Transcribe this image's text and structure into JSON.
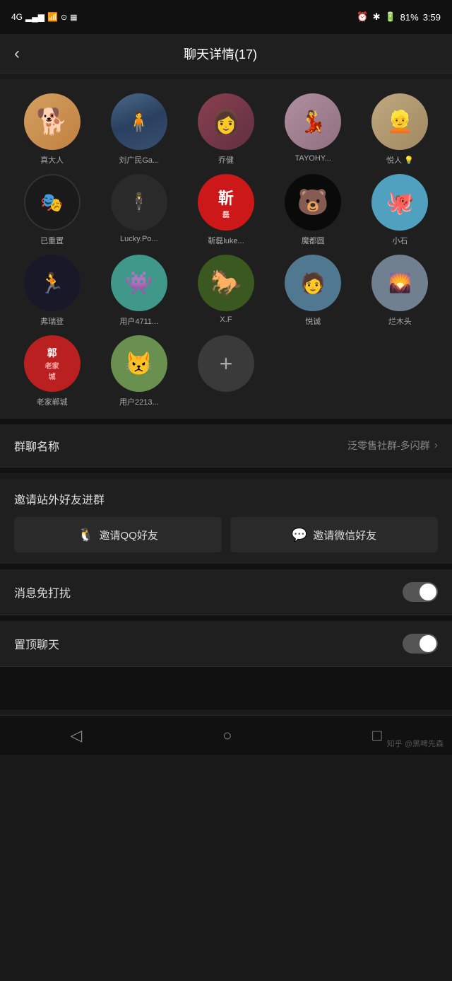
{
  "statusBar": {
    "signal": "4G",
    "time": "3:59",
    "battery": "81%",
    "icons": [
      "alarm",
      "bluetooth",
      "signal-bar"
    ]
  },
  "header": {
    "backLabel": "‹",
    "title": "聊天详情(17)"
  },
  "members": [
    {
      "id": 1,
      "name": "真大人",
      "avatarType": "shiba",
      "avatarText": "🐕"
    },
    {
      "id": 2,
      "name": "刘广民Ga...",
      "avatarType": "landscape",
      "avatarText": "🏔"
    },
    {
      "id": 3,
      "name": "乔健",
      "avatarType": "redgirl",
      "avatarText": "👩"
    },
    {
      "id": 4,
      "name": "TAYOHY...",
      "avatarType": "qipao",
      "avatarText": "👗"
    },
    {
      "id": 5,
      "name": "悦人 💡",
      "avatarType": "pinup",
      "avatarText": "👱"
    },
    {
      "id": 6,
      "name": "已重置",
      "avatarType": "tiktok",
      "avatarText": "🎭"
    },
    {
      "id": 7,
      "name": "Lucky.Po...",
      "avatarType": "lucky",
      "avatarText": "🕴"
    },
    {
      "id": 8,
      "name": "靳磊luke...",
      "avatarType": "jinluo",
      "avatarText": "靳"
    },
    {
      "id": 9,
      "name": "魔都圆",
      "avatarType": "bear",
      "avatarText": "🐻"
    },
    {
      "id": 10,
      "name": "小石",
      "avatarType": "blue",
      "avatarText": "🦑"
    },
    {
      "id": 11,
      "name": "弗瑞登",
      "avatarType": "runner",
      "avatarText": "🏃"
    },
    {
      "id": 12,
      "name": "用户4711...",
      "avatarType": "monster",
      "avatarText": "👾"
    },
    {
      "id": 13,
      "name": "X.F",
      "avatarType": "horse",
      "avatarText": "🐎"
    },
    {
      "id": 14,
      "name": "悦诚",
      "avatarType": "yucheng",
      "avatarText": "🧑"
    },
    {
      "id": 15,
      "name": "烂木头",
      "avatarType": "wood",
      "avatarText": "🌄"
    },
    {
      "id": 16,
      "name": "老家郸城",
      "avatarType": "guo",
      "avatarText": "郭"
    },
    {
      "id": 17,
      "name": "用户2213...",
      "avatarType": "user2213",
      "avatarText": "😾"
    }
  ],
  "addButton": {
    "label": "+"
  },
  "settings": {
    "groupNameLabel": "群聊名称",
    "groupNameValue": "泛零售社群-多闪群",
    "inviteTitle": "邀请站外好友进群",
    "inviteQQ": "邀请QQ好友",
    "inviteWechat": "邀请微信好友",
    "muteLabel": "消息免打扰",
    "pinLabel": "置顶聊天"
  },
  "bottomNav": {
    "backIcon": "◁",
    "homeIcon": "○",
    "recentIcon": "□",
    "watermark": "知乎 @黑啤先森"
  },
  "avatarColors": {
    "shiba": "#c8943a",
    "landscape": "#4a6878",
    "redgirl": "#7a3545",
    "qipao": "#9a7080",
    "pinup": "#b89060",
    "tiktok": "#222222",
    "lucky": "#333333",
    "jinluo": "#c01818",
    "bear": "#111111",
    "blue": "#4080a0",
    "runner": "#181828",
    "monster": "#40988a",
    "horse": "#3a5825",
    "yucheng": "#508090",
    "wood": "#708090",
    "guo": "#bb2020",
    "user2213": "#6a9050"
  }
}
